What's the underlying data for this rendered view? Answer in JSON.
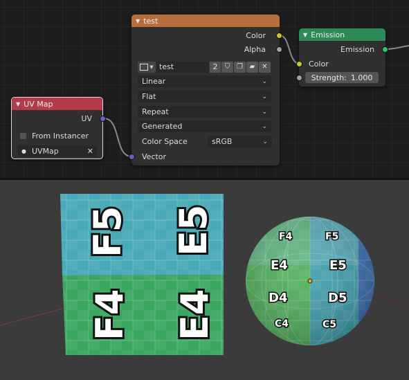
{
  "node_editor": {
    "image_node": {
      "title": "test",
      "outputs": {
        "color": "Color",
        "alpha": "Alpha"
      },
      "image_name": "test",
      "users_count": "2",
      "interpolation": "Linear",
      "projection": "Flat",
      "extension": "Repeat",
      "source": "Generated",
      "color_space_label": "Color Space",
      "color_space_value": "sRGB",
      "input_vector": "Vector"
    },
    "emission_node": {
      "title": "Emission",
      "output": "Emission",
      "input_color": "Color",
      "strength_label": "Strength:",
      "strength_value": "1.000"
    },
    "uvmap_node": {
      "title": "UV Map",
      "output": "UV",
      "from_instancer_label": "From Instancer",
      "from_instancer_checked": false,
      "uv_map_value": "UVMap"
    }
  },
  "viewport": {
    "plane_labels": [
      "F5",
      "E5",
      "F4",
      "E4"
    ],
    "sphere_labels": [
      "F4",
      "F5",
      "E4",
      "E5",
      "D4",
      "D5",
      "C4",
      "C5"
    ]
  },
  "colors": {
    "image_header": "#b86e3a",
    "emission_header": "#2e8a56",
    "uvmap_header": "#b53a4a",
    "yellow_socket": "#c7c729",
    "gray_socket": "#a1a1a1",
    "vector_socket": "#6363c7"
  }
}
